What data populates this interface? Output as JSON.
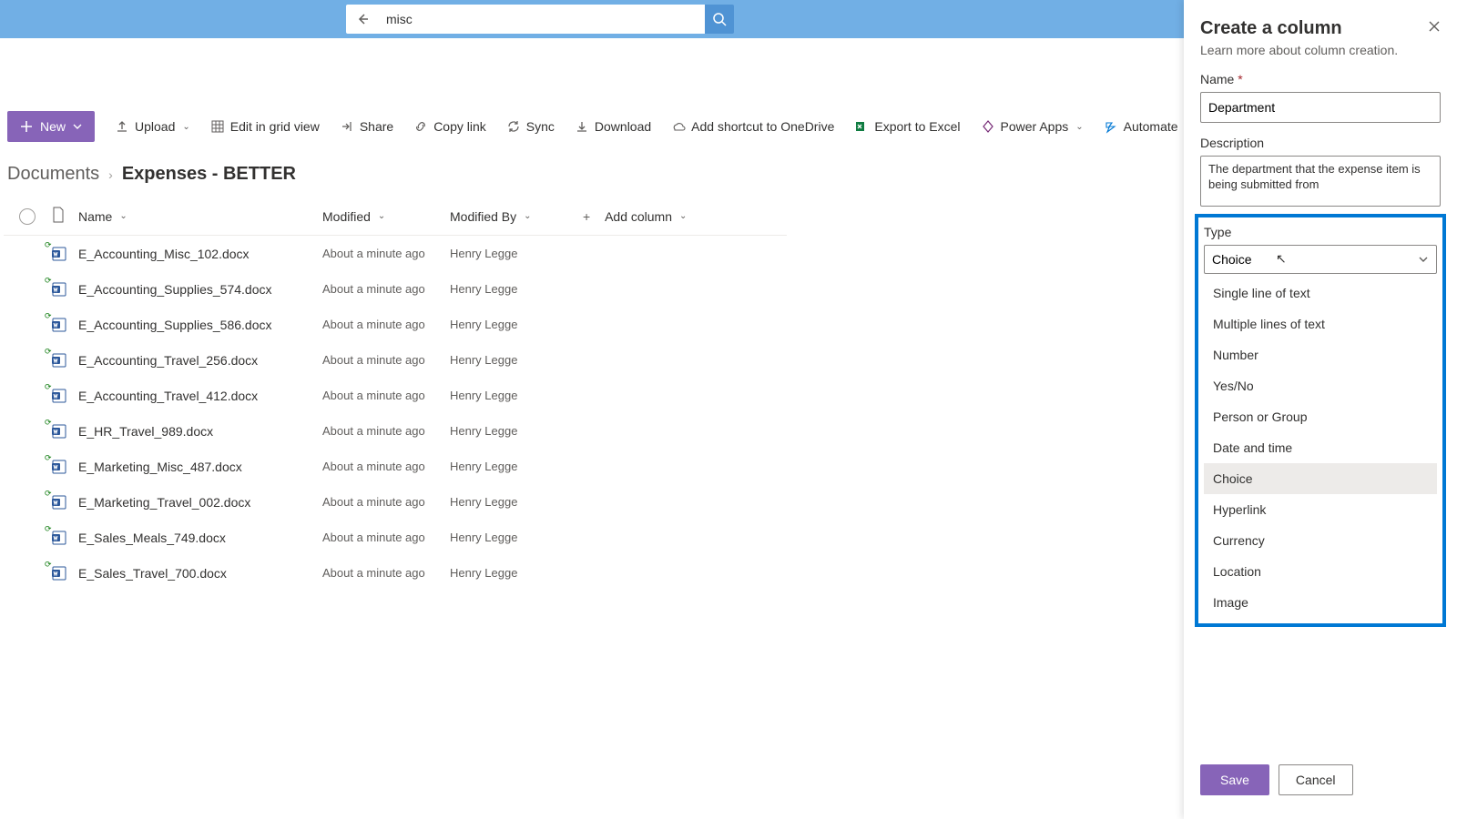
{
  "search": {
    "value": "misc"
  },
  "toolbar": {
    "new": "New",
    "upload": "Upload",
    "editGrid": "Edit in grid view",
    "share": "Share",
    "copyLink": "Copy link",
    "sync": "Sync",
    "download": "Download",
    "addShortcut": "Add shortcut to OneDrive",
    "export": "Export to Excel",
    "powerApps": "Power Apps",
    "automate": "Automate"
  },
  "breadcrumb": {
    "root": "Documents",
    "current": "Expenses - BETTER"
  },
  "columns": {
    "name": "Name",
    "modified": "Modified",
    "modifiedBy": "Modified By",
    "add": "Add column"
  },
  "rows": [
    {
      "name": "E_Accounting_Misc_102.docx",
      "modified": "About a minute ago",
      "by": "Henry Legge"
    },
    {
      "name": "E_Accounting_Supplies_574.docx",
      "modified": "About a minute ago",
      "by": "Henry Legge"
    },
    {
      "name": "E_Accounting_Supplies_586.docx",
      "modified": "About a minute ago",
      "by": "Henry Legge"
    },
    {
      "name": "E_Accounting_Travel_256.docx",
      "modified": "About a minute ago",
      "by": "Henry Legge"
    },
    {
      "name": "E_Accounting_Travel_412.docx",
      "modified": "About a minute ago",
      "by": "Henry Legge"
    },
    {
      "name": "E_HR_Travel_989.docx",
      "modified": "About a minute ago",
      "by": "Henry Legge"
    },
    {
      "name": "E_Marketing_Misc_487.docx",
      "modified": "About a minute ago",
      "by": "Henry Legge"
    },
    {
      "name": "E_Marketing_Travel_002.docx",
      "modified": "About a minute ago",
      "by": "Henry Legge"
    },
    {
      "name": "E_Sales_Meals_749.docx",
      "modified": "About a minute ago",
      "by": "Henry Legge"
    },
    {
      "name": "E_Sales_Travel_700.docx",
      "modified": "About a minute ago",
      "by": "Henry Legge"
    }
  ],
  "panel": {
    "title": "Create a column",
    "learn": "Learn more about column creation.",
    "nameLabel": "Name",
    "nameValue": "Department",
    "descLabel": "Description",
    "descValue": "The department that the expense item is being submitted from",
    "typeLabel": "Type",
    "typeSelected": "Choice",
    "options": [
      "Single line of text",
      "Multiple lines of text",
      "Number",
      "Yes/No",
      "Person or Group",
      "Date and time",
      "Choice",
      "Hyperlink",
      "Currency",
      "Location",
      "Image"
    ],
    "save": "Save",
    "cancel": "Cancel"
  }
}
